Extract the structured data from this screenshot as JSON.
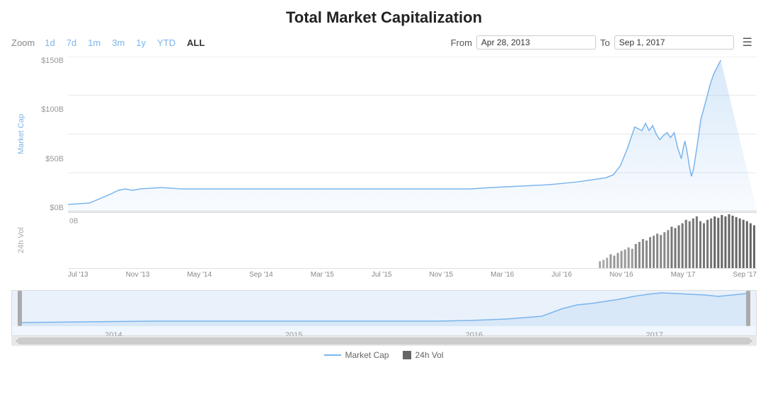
{
  "title": "Total Market Capitalization",
  "zoom": {
    "label": "Zoom",
    "options": [
      "1d",
      "7d",
      "1m",
      "3m",
      "1y",
      "YTD",
      "ALL"
    ],
    "active": "ALL"
  },
  "dateRange": {
    "fromLabel": "From",
    "fromValue": "Apr 28, 2013",
    "toLabel": "To",
    "toValue": "Sep 1, 2017"
  },
  "yAxis": {
    "marketCap": {
      "label": "Market Cap",
      "ticks": [
        "$150B",
        "$100B",
        "$50B",
        "$0B"
      ]
    },
    "volume": {
      "label": "24h Vol",
      "ticks": [
        "0B"
      ]
    }
  },
  "xAxis": {
    "labels": [
      "Jul '13",
      "Nov '13",
      "May '14",
      "Sep '14",
      "Mar '15",
      "Jul '15",
      "Nov '15",
      "Mar '16",
      "Jul '16",
      "Nov '16",
      "May '17",
      "Sep '17"
    ]
  },
  "navigator": {
    "labels": [
      "2014",
      "2015",
      "2016",
      "2017"
    ]
  },
  "legend": {
    "items": [
      {
        "label": "Market Cap",
        "type": "line",
        "color": "#7cb5ec"
      },
      {
        "label": "24h Vol",
        "type": "box",
        "color": "#666666"
      }
    ]
  },
  "colors": {
    "accent": "#7cb5ec",
    "grid": "#e8e8e8",
    "volBar": "#555555"
  }
}
